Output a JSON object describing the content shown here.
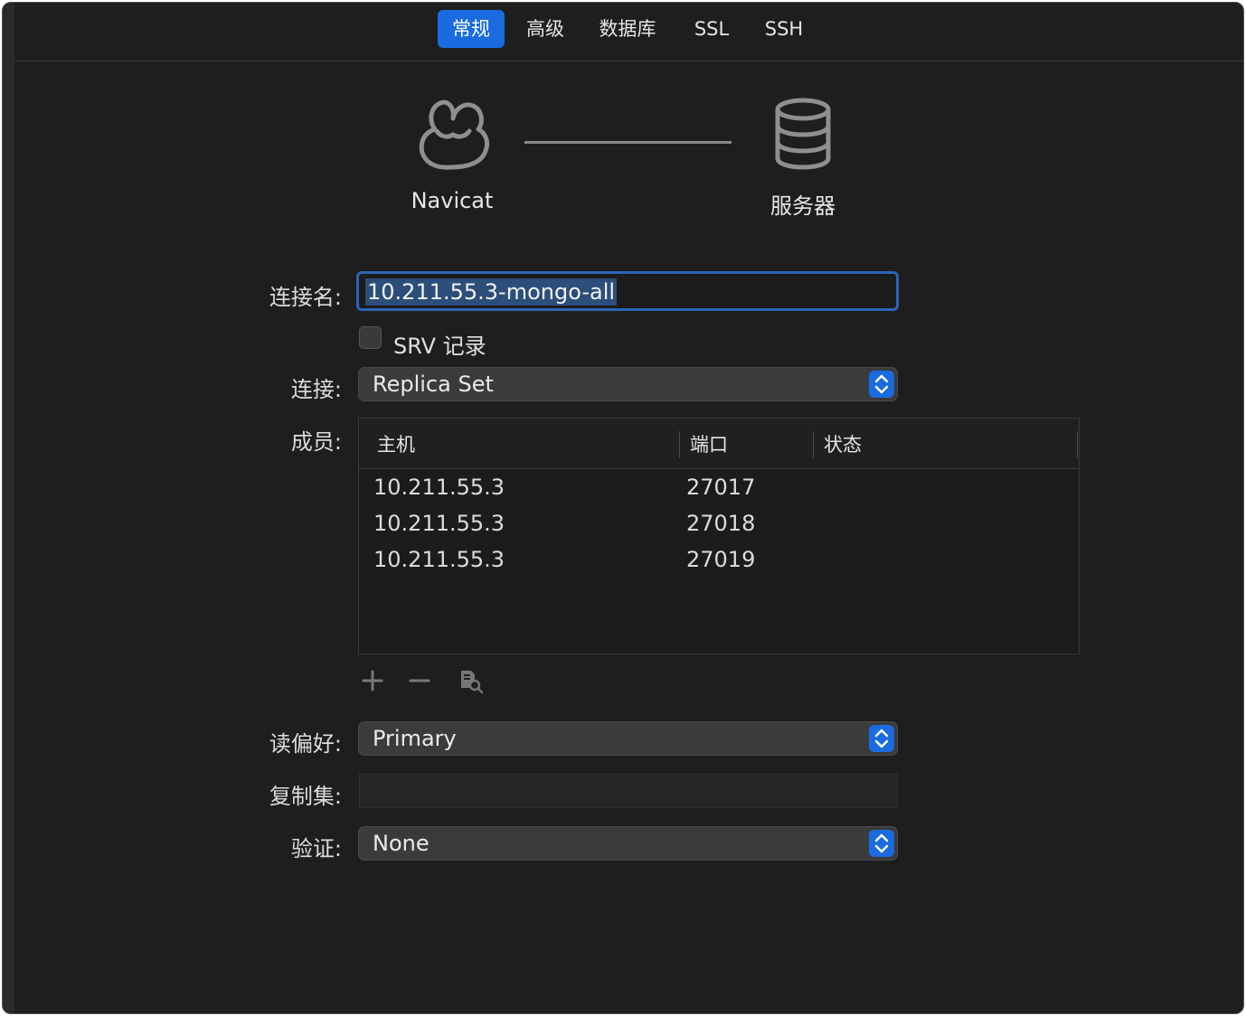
{
  "tabs": [
    {
      "label": "常规",
      "active": true
    },
    {
      "label": "高级",
      "active": false
    },
    {
      "label": "数据库",
      "active": false
    },
    {
      "label": "SSL",
      "active": false
    },
    {
      "label": "SSH",
      "active": false
    }
  ],
  "hero": {
    "client_label": "Navicat",
    "server_label": "服务器"
  },
  "form": {
    "connection_name_label": "连接名:",
    "connection_name_value": "10.211.55.3-mongo-all",
    "srv_label": "SRV 记录",
    "srv_checked": false,
    "connection_label": "连接:",
    "connection_value": "Replica Set",
    "members_label": "成员:",
    "read_pref_label": "读偏好:",
    "read_pref_value": "Primary",
    "replica_set_label": "复制集:",
    "replica_set_value": "",
    "auth_label": "验证:",
    "auth_value": "None"
  },
  "members_table": {
    "columns": [
      "主机",
      "端口",
      "状态"
    ],
    "rows": [
      {
        "host": "10.211.55.3",
        "port": "27017",
        "status": ""
      },
      {
        "host": "10.211.55.3",
        "port": "27018",
        "status": ""
      },
      {
        "host": "10.211.55.3",
        "port": "27019",
        "status": ""
      }
    ]
  },
  "toolbar_icons": [
    "plus-icon",
    "minus-icon",
    "discover-icon"
  ],
  "colors": {
    "accent": "#1a6be0",
    "background": "#1e1e1e",
    "focus_ring": "#2b64b8"
  }
}
